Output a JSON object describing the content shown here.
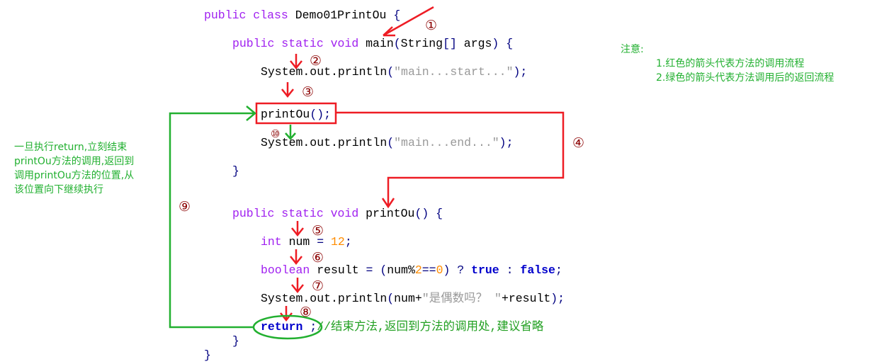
{
  "code_lines": [
    [
      [
        "public class ",
        "kw"
      ],
      [
        "Demo01PrintOu ",
        "id"
      ],
      [
        "{",
        "br"
      ]
    ],
    [
      [
        "public static void ",
        "kw"
      ],
      [
        "main",
        "id"
      ],
      [
        "(",
        "br"
      ],
      [
        "String",
        "id"
      ],
      [
        "[] ",
        "br"
      ],
      [
        "args",
        "id"
      ],
      [
        ") {",
        "br"
      ]
    ],
    [
      [
        "System.out.println",
        "id"
      ],
      [
        "(",
        "br"
      ],
      [
        "\"main...start...\"",
        "str"
      ],
      [
        ");",
        "br"
      ]
    ],
    [
      [
        "printOu",
        "id"
      ],
      [
        "();",
        "br"
      ]
    ],
    [
      [
        "System.out.println",
        "id"
      ],
      [
        "(",
        "br"
      ],
      [
        "\"main...end...\"",
        "str"
      ],
      [
        ");",
        "br"
      ]
    ],
    [
      [
        "}",
        "br"
      ]
    ],
    [
      [
        "public static void ",
        "kw"
      ],
      [
        "printOu",
        "id"
      ],
      [
        "() {",
        "br"
      ]
    ],
    [
      [
        "int ",
        "kw"
      ],
      [
        "num ",
        "id"
      ],
      [
        "= ",
        "br"
      ],
      [
        "12",
        "num"
      ],
      [
        ";",
        "br"
      ]
    ],
    [
      [
        "boolean ",
        "kw"
      ],
      [
        "result ",
        "id"
      ],
      [
        "= (",
        "br"
      ],
      [
        "num%",
        "id"
      ],
      [
        "2",
        "num"
      ],
      [
        "==",
        "br"
      ],
      [
        "0",
        "num"
      ],
      [
        ") ? ",
        "br"
      ],
      [
        "true",
        "bk"
      ],
      [
        " : ",
        "br"
      ],
      [
        "false",
        "bk"
      ],
      [
        ";",
        "br"
      ]
    ],
    [
      [
        "System.out.println",
        "id"
      ],
      [
        "(",
        "br"
      ],
      [
        "num+",
        "id"
      ],
      [
        "\"是偶数吗？ \"",
        "str"
      ],
      [
        "+result",
        "id"
      ],
      [
        ");",
        "br"
      ]
    ],
    [
      [
        "return",
        "bk"
      ],
      [
        " ;",
        "br"
      ],
      [
        "//结束方法,返回到方法的调用处,建议省略",
        "cm"
      ]
    ],
    [
      [
        "}",
        "br"
      ]
    ],
    [
      [
        "}",
        "br"
      ]
    ]
  ],
  "steps": [
    "①",
    "②",
    "③",
    "④",
    "⑤",
    "⑥",
    "⑦",
    "⑧",
    "⑨",
    "⑩"
  ],
  "left_note": [
    "一旦执行return,立刻结束",
    "printOu方法的调用,返回到",
    "调用printOu方法的位置,从",
    "该位置向下继续执行"
  ],
  "right_note": {
    "title": "注意:",
    "items": [
      "1.红色的箭头代表方法的调用流程",
      "2.绿色的箭头代表方法调用后的返回流程"
    ]
  },
  "colors": {
    "call_arrow": "#ee1c24",
    "return_arrow": "#22b030",
    "step_number": "#8b0000"
  }
}
